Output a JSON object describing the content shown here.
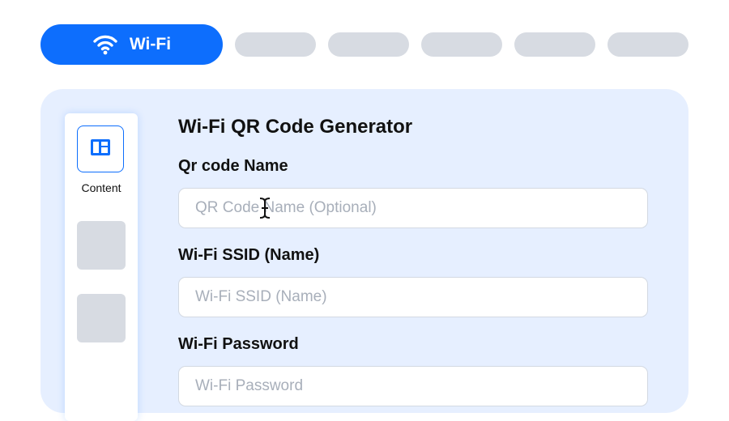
{
  "tabs": {
    "active": {
      "label": "Wi-Fi",
      "icon": "wifi-icon"
    },
    "placeholder_count": 5
  },
  "sidebar": {
    "active_item": {
      "label": "Content",
      "icon": "content-layout-icon"
    }
  },
  "form": {
    "title": "Wi-Fi QR Code Generator",
    "fields": [
      {
        "label": "Qr code Name",
        "placeholder": "QR Code Name (Optional)"
      },
      {
        "label": "Wi-Fi SSID (Name)",
        "placeholder": "Wi-Fi SSID (Name)"
      },
      {
        "label": "Wi-Fi Password",
        "placeholder": "Wi-Fi Password"
      }
    ]
  },
  "colors": {
    "accent": "#0d6efd",
    "panel_bg": "#e6efff",
    "placeholder_gray": "#d7dbe2"
  }
}
